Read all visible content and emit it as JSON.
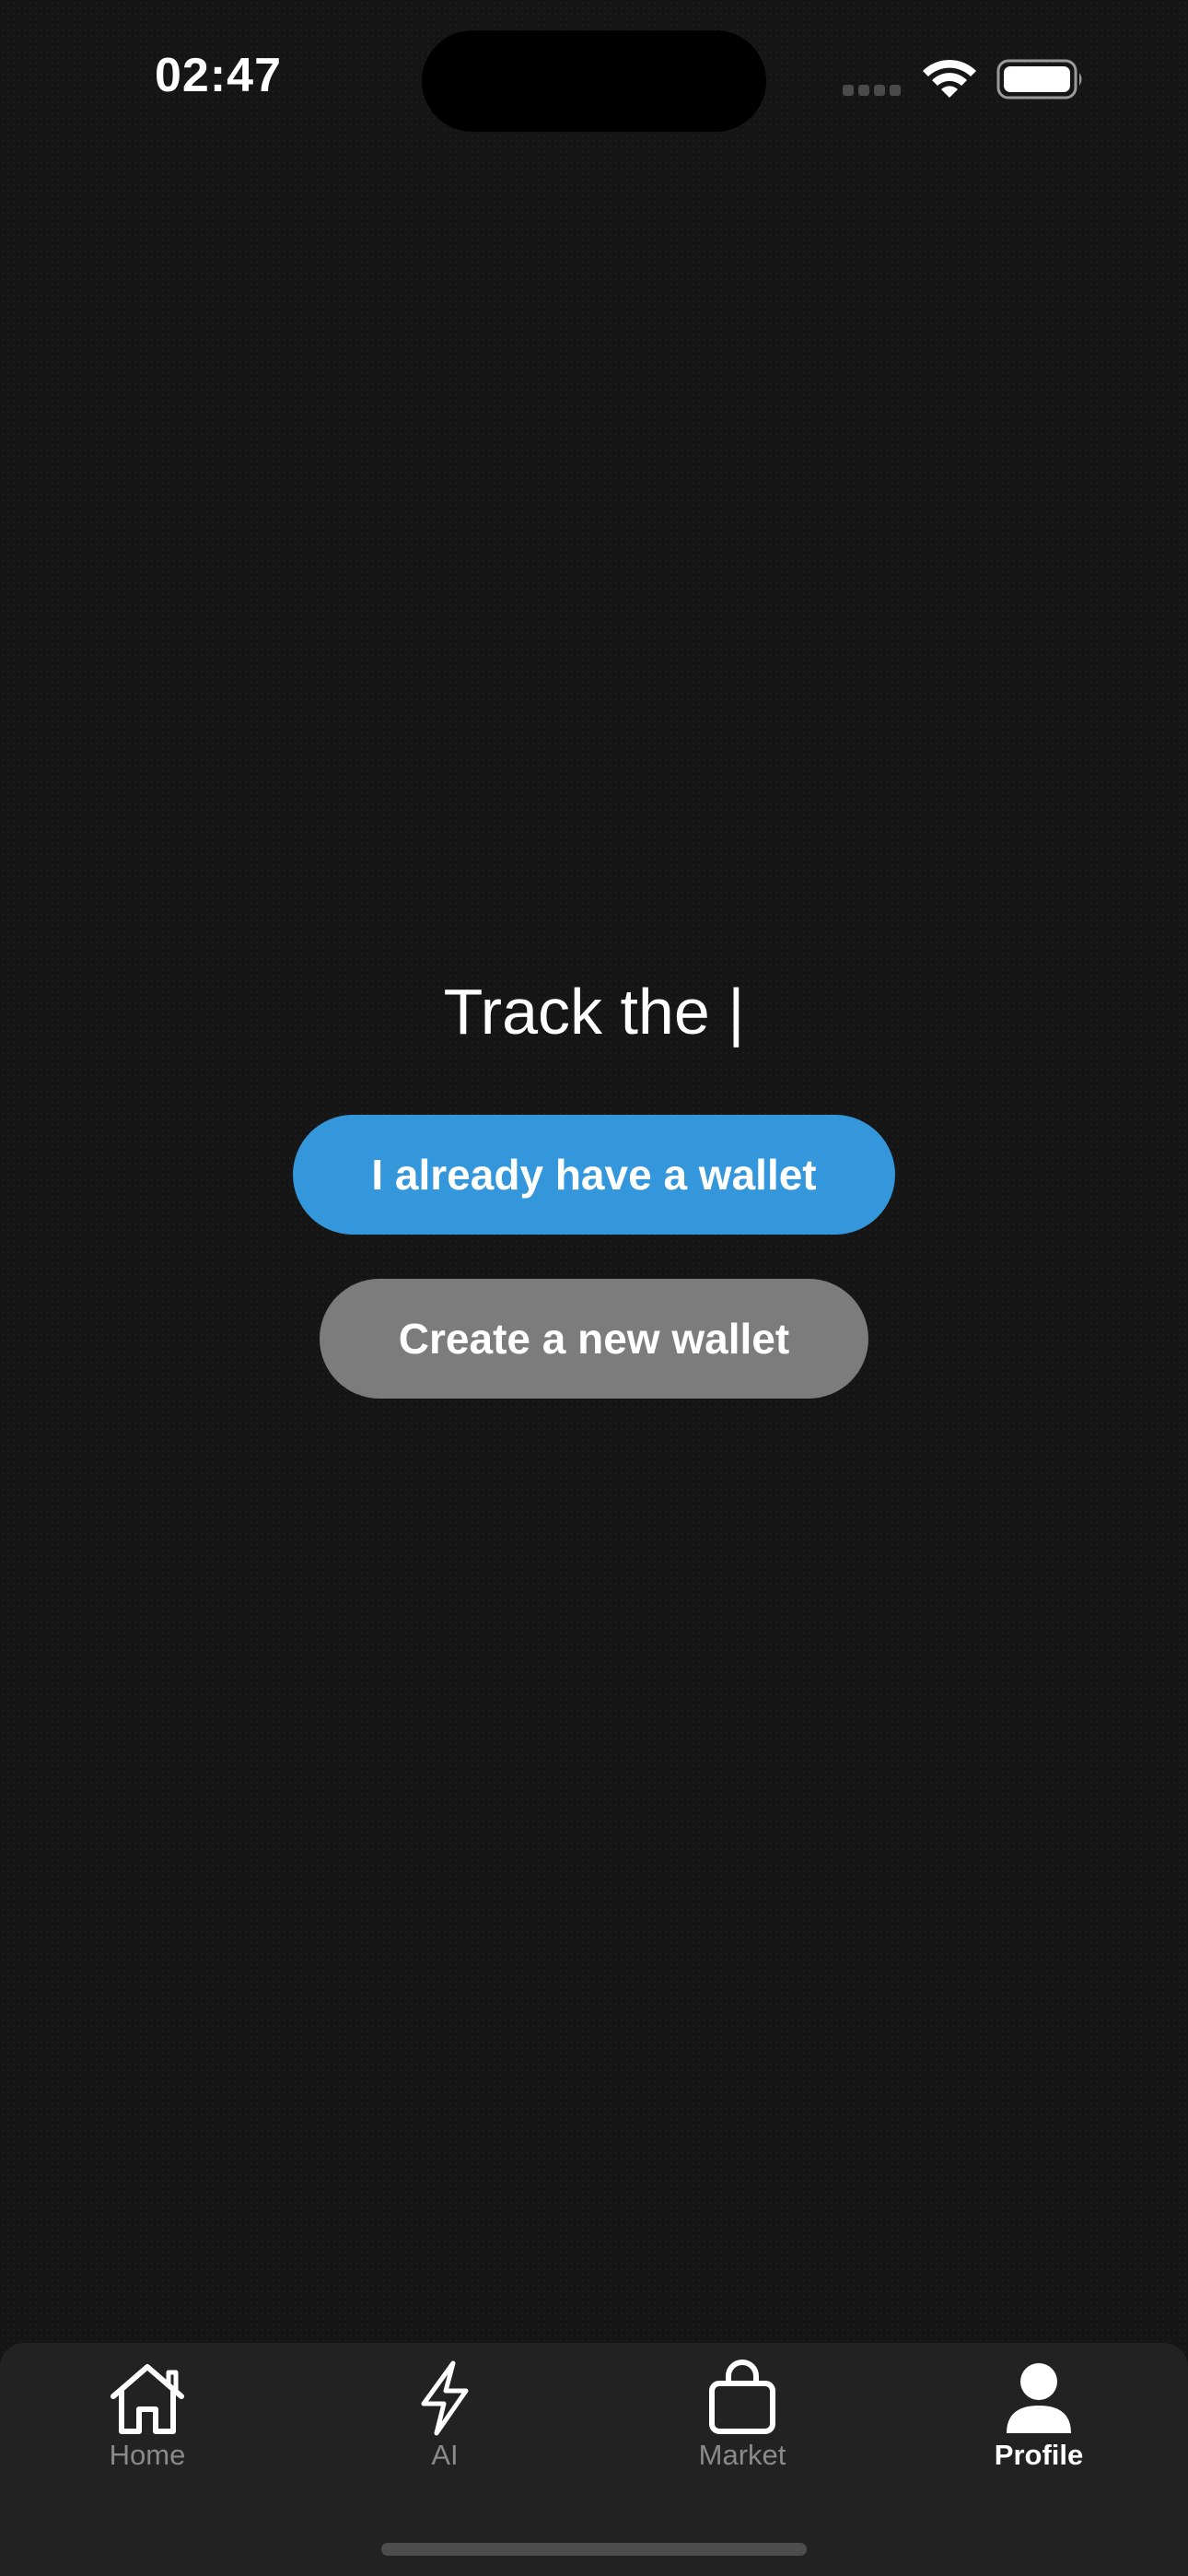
{
  "status_bar": {
    "time": "02:47",
    "wifi_icon": "wifi-icon",
    "battery_icon": "battery-icon",
    "signal_icon": "cellular-signal-icon"
  },
  "main": {
    "headline": "Track the |",
    "primary_button_label": "I already have a wallet",
    "secondary_button_label": "Create a new wallet"
  },
  "tab_bar": {
    "tabs": [
      {
        "label": "Home",
        "icon": "home-icon",
        "active": false
      },
      {
        "label": "AI",
        "icon": "lightning-bolt-icon",
        "active": false
      },
      {
        "label": "Market",
        "icon": "shopping-bag-icon",
        "active": false
      },
      {
        "label": "Profile",
        "icon": "person-icon",
        "active": true
      }
    ]
  },
  "colors": {
    "background": "#151515",
    "primary_button": "#3497dc",
    "secondary_button": "#7c7c7c",
    "tab_bar": "#222222",
    "tab_inactive": "#8a8a8a",
    "tab_active": "#ffffff"
  }
}
